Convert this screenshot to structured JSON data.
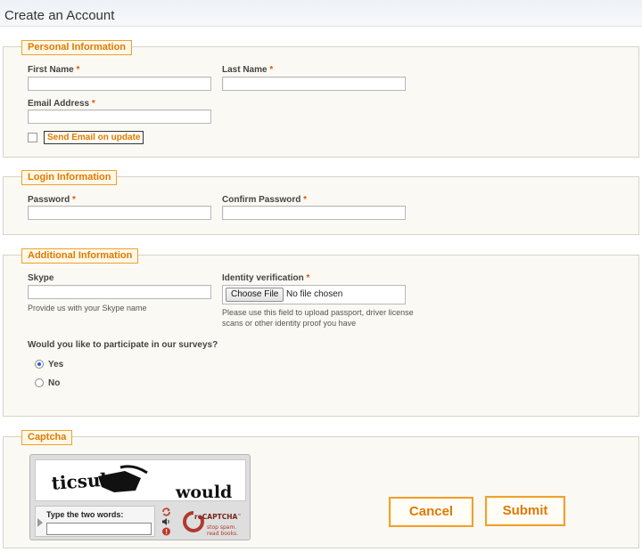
{
  "page": {
    "title": "Create an Account"
  },
  "personal": {
    "legend": "Personal Information",
    "first_name_label": "First Name",
    "last_name_label": "Last Name",
    "email_label": "Email Address",
    "required_mark": "*",
    "send_email_label": "Send Email on update",
    "send_email_checked": false
  },
  "login": {
    "legend": "Login Information",
    "password_label": "Password",
    "confirm_password_label": "Confirm Password",
    "required_mark": "*"
  },
  "additional": {
    "legend": "Additional Information",
    "skype_label": "Skype",
    "skype_hint": "Provide us with your Skype name",
    "identity_label": "Identity verification",
    "required_mark": "*",
    "choose_file_label": "Choose File",
    "file_status": "No file chosen",
    "identity_hint_line1": "Please use this field to upload passport, driver license",
    "identity_hint_line2": "scans or other identity proof you have",
    "survey_question": "Would you like to participate in our surveys?",
    "survey_options": [
      "Yes",
      "No"
    ],
    "survey_selected": "Yes"
  },
  "captcha": {
    "legend": "Captcha",
    "word1": "ticsuka",
    "word2": "would",
    "prompt": "Type the two words:",
    "logo_brand": "reCAPTCHA",
    "logo_tm": "™",
    "logo_tagline1": "stop spam.",
    "logo_tagline2": "read books."
  },
  "actions": {
    "cancel_label": "Cancel",
    "submit_label": "Submit"
  },
  "colors": {
    "accent": "#e07a00",
    "accent_border": "#f0a030",
    "section_bg": "#fbf9f3"
  }
}
